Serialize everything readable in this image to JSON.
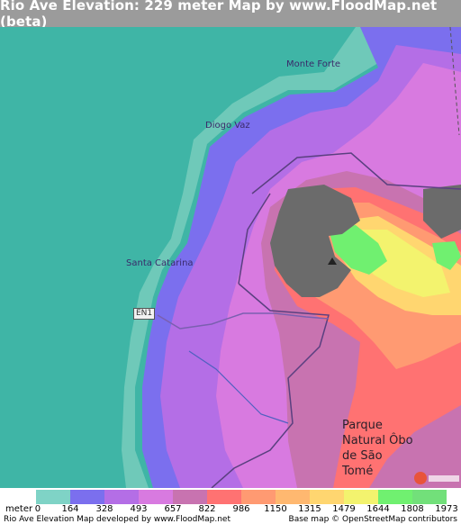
{
  "title": "Rio Ave Elevation: 229 meter Map by www.FloodMap.net (beta)",
  "places": {
    "monte_forte": "Monte Forte",
    "diogo_vaz": "Diogo Vaz",
    "santa_catarina": "Santa Catarina",
    "road_en1": "EN1",
    "park": "Parque Natural Ôbo de São Tomé"
  },
  "legend": {
    "unit": "meter",
    "ticks": [
      "0",
      "164",
      "328",
      "493",
      "657",
      "822",
      "986",
      "1150",
      "1315",
      "1479",
      "1644",
      "1808",
      "1973"
    ],
    "colors": [
      "#7fd3c6",
      "#7b6fee",
      "#b46ee6",
      "#d87ae0",
      "#c873b0",
      "#ff7272",
      "#ff9a72",
      "#ffb870",
      "#ffd670",
      "#f3f36e",
      "#70f070",
      "#72e07a"
    ]
  },
  "credits": {
    "left": "Rio Ave Elevation Map developed by www.FloodMap.net",
    "right": "Base map © OpenStreetMap contributors"
  },
  "colors": {
    "sea": "#3fb5a6",
    "coast": "#6fc9b9",
    "low": "#7b6fee",
    "mid": "#b46ee6",
    "high": "#d87ae0",
    "peak_gray": "#6b6b6b",
    "peak_green": "#70f070",
    "peak_yellow": "#f3f36e",
    "peak_orange": "#ff9a72"
  }
}
